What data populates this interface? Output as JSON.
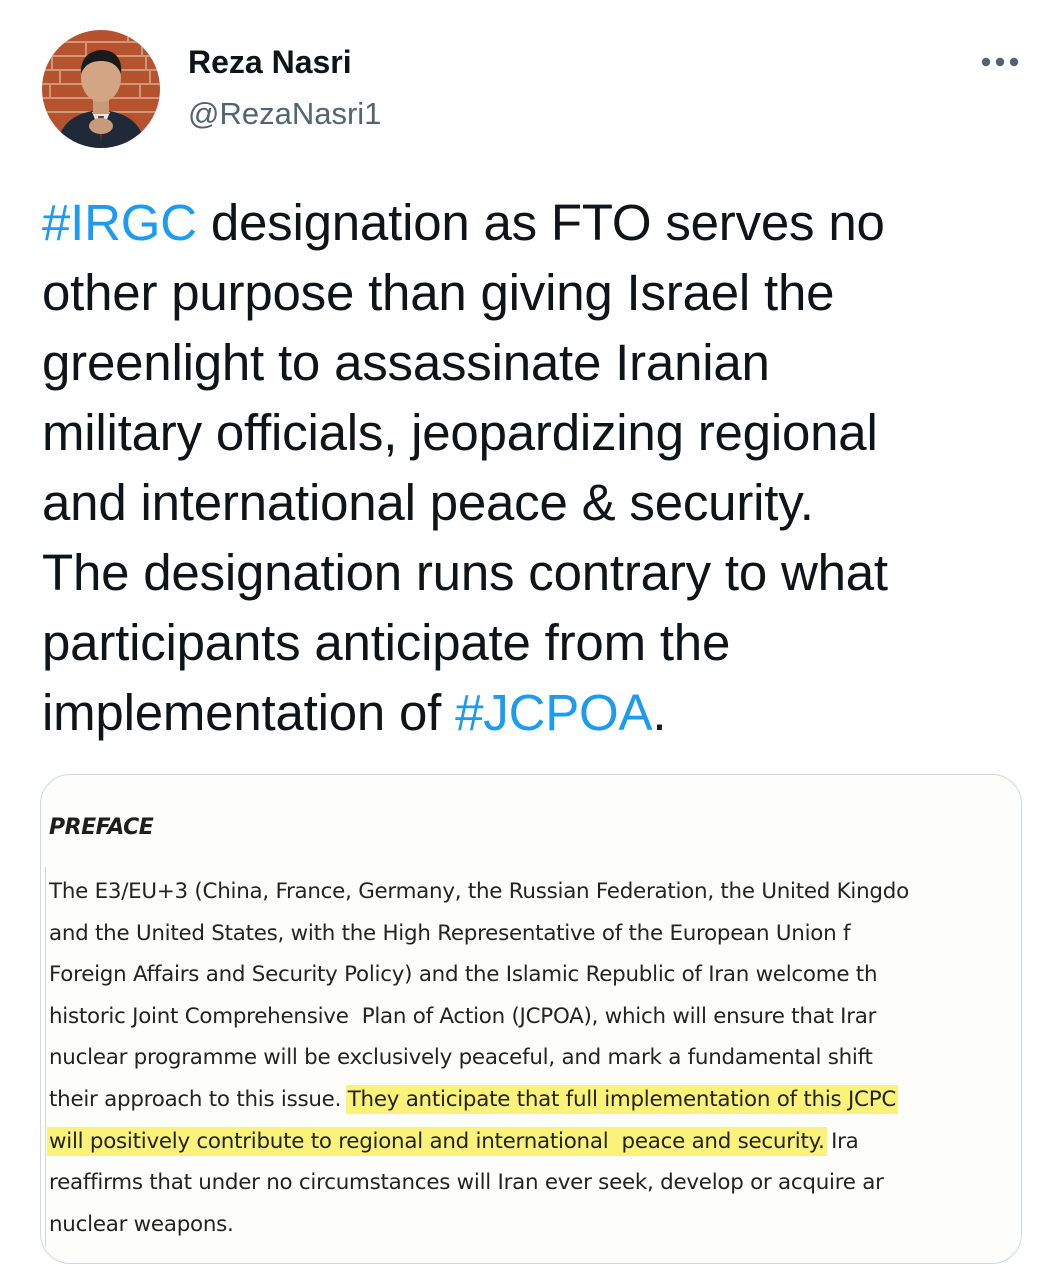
{
  "author": {
    "display_name": "Reza Nasri",
    "handle": "@RezaNasri1",
    "avatar_icon": "profile-photo"
  },
  "menu": {
    "icon": "more-dots-icon"
  },
  "tweet": {
    "lines": [
      [
        {
          "text": "#IRGC",
          "hashtag": true
        },
        {
          "text": " designation as FTO serves no"
        }
      ],
      [
        {
          "text": "other purpose than giving Israel the"
        }
      ],
      [
        {
          "text": "greenlight to assassinate Iranian"
        }
      ],
      [
        {
          "text": "military officials, jeopardizing regional"
        }
      ],
      [
        {
          "text": "and international peace & security."
        }
      ],
      [
        {
          "text": "The designation runs contrary to what"
        }
      ],
      [
        {
          "text": "participants anticipate from the"
        }
      ],
      [
        {
          "text": "implementation of "
        },
        {
          "text": "#JCPOA",
          "hashtag": true
        },
        {
          "text": "."
        }
      ]
    ]
  },
  "document": {
    "heading": "PREFACE",
    "lines": [
      [
        {
          "text": "The E3/EU+3 (China, France, Germany, the Russian Federation, the United Kingdo"
        }
      ],
      [
        {
          "text": "and the United States, with the High Representative of the European Union f"
        }
      ],
      [
        {
          "text": "Foreign Affairs and Security Policy) and the Islamic Republic of Iran welcome th"
        }
      ],
      [
        {
          "text": "historic Joint Comprehensive  Plan of Action (JCPOA), which will ensure that Irar"
        }
      ],
      [
        {
          "text": "nuclear programme will be exclusively peaceful, and mark a fundamental shift"
        }
      ],
      [
        {
          "text": "their approach to this issue. "
        },
        {
          "text": "They anticipate that full implementation of this JCPC",
          "highlight": true
        }
      ],
      [
        {
          "text": "will positively contribute to regional and international  peace and security.",
          "highlight": true
        },
        {
          "text": " Ira"
        }
      ],
      [
        {
          "text": "reaffirms that under no circumstances will Iran ever seek, develop or acquire ar"
        }
      ],
      [
        {
          "text": "nuclear weapons."
        }
      ]
    ],
    "highlight_color": "#fbf27a"
  },
  "colors": {
    "hashtag": "#1d9bf0",
    "text": "#0f1419",
    "secondary": "#536471"
  }
}
